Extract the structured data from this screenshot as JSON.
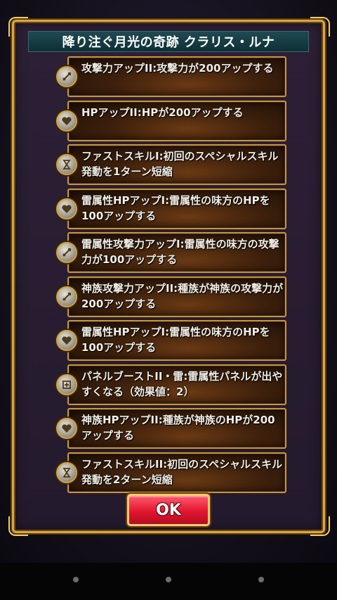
{
  "dialog": {
    "title": "降り注ぐ月光の奇跡 クラリス・ルナ"
  },
  "skills": [
    {
      "text": "攻撃力アップII:攻撃力が200アップする",
      "icon": "sword-up-icon"
    },
    {
      "text": "HPアップII:HPが200アップする",
      "icon": "heart-up-icon"
    },
    {
      "text": "ファストスキルI:初回のスペシャルスキル発動を1ターン短縮",
      "icon": "hourglass-icon"
    },
    {
      "text": "雷属性HPアップI:雷属性の味方のHPを100アップする",
      "icon": "heart-up-icon"
    },
    {
      "text": "雷属性攻撃力アップI:雷属性の味方の攻撃力が100アップする",
      "icon": "sword-up-icon"
    },
    {
      "text": "神族攻撃力アップII:種族が神族の攻撃力が200アップする",
      "icon": "sword-up-icon"
    },
    {
      "text": "雷属性HPアップI:雷属性の味方のHPを100アップする",
      "icon": "heart-up-icon"
    },
    {
      "text": "パネルブーストII・雷:雷属性パネルが出やすくなる（効果値：2）",
      "icon": "panel-boost-icon"
    },
    {
      "text": "神族HPアップII:種族が神族のHPが200アップする",
      "icon": "heart-up-icon"
    },
    {
      "text": "ファストスキルII:初回のスペシャルスキル発動を2ターン短縮",
      "icon": "hourglass-icon"
    }
  ],
  "ok_button": {
    "label": "OK"
  },
  "colors": {
    "frame_gold": "#d9a83f",
    "title_bar": "#1f4a52",
    "ok_red": "#e2162f"
  }
}
